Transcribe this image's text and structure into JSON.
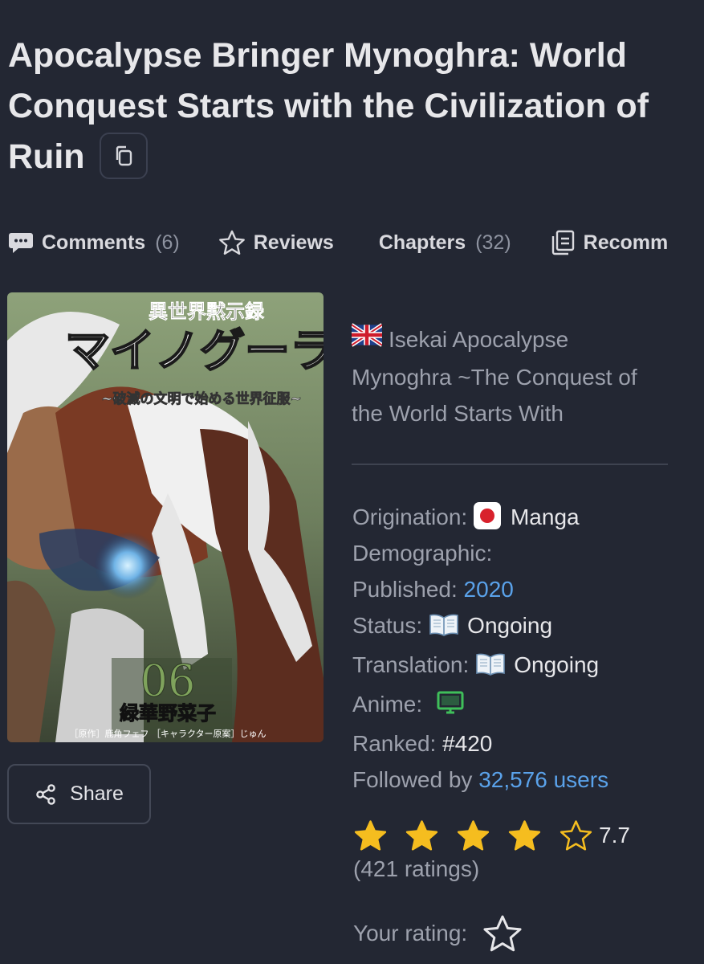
{
  "title": "Apocalypse Bringer Mynoghra: World Conquest Starts with the Civilization of Ruin",
  "copy_icon": "copy-icon",
  "tabs": [
    {
      "label": "Comments",
      "count": "(6)",
      "icon": "comment-icon"
    },
    {
      "label": "Reviews",
      "count": "",
      "icon": "star-outline-icon"
    },
    {
      "label": "Chapters",
      "count": "(32)",
      "icon": ""
    },
    {
      "label": "Recomm",
      "count": "",
      "icon": "recommend-icon"
    }
  ],
  "cover": {
    "top_title": "異世界黙示録",
    "main_title": "マイノグーラ",
    "subtitle": "~破滅の文明で始める世界征服~",
    "volume": "06",
    "author": "緑華野菜子",
    "credits": "［原作］鹿角フェフ ［キャラクター原案］じゅん"
  },
  "share_label": "Share",
  "alt_title": "Isekai Apocalypse Mynoghra ~The Conquest of the World Starts With",
  "meta": {
    "origination_label": "Origination:",
    "origination_value": "Manga",
    "demographic_label": "Demographic:",
    "published_label": "Published:",
    "published_value": "2020",
    "status_label": "Status:",
    "status_value": "Ongoing",
    "translation_label": "Translation:",
    "translation_value": "Ongoing",
    "anime_label": "Anime:",
    "ranked_label": "Ranked:",
    "ranked_value": "#420",
    "followed_label": "Followed by",
    "followed_value": "32,576 users"
  },
  "rating": {
    "score": "7.7",
    "filled_stars": 4,
    "total_stars": 5,
    "ratings_text": "(421 ratings)",
    "your_rating_label": "Your rating:"
  },
  "colors": {
    "background": "#232733",
    "link": "#5aa2ea",
    "star": "#f5bd1f",
    "muted": "#9da1ad"
  }
}
